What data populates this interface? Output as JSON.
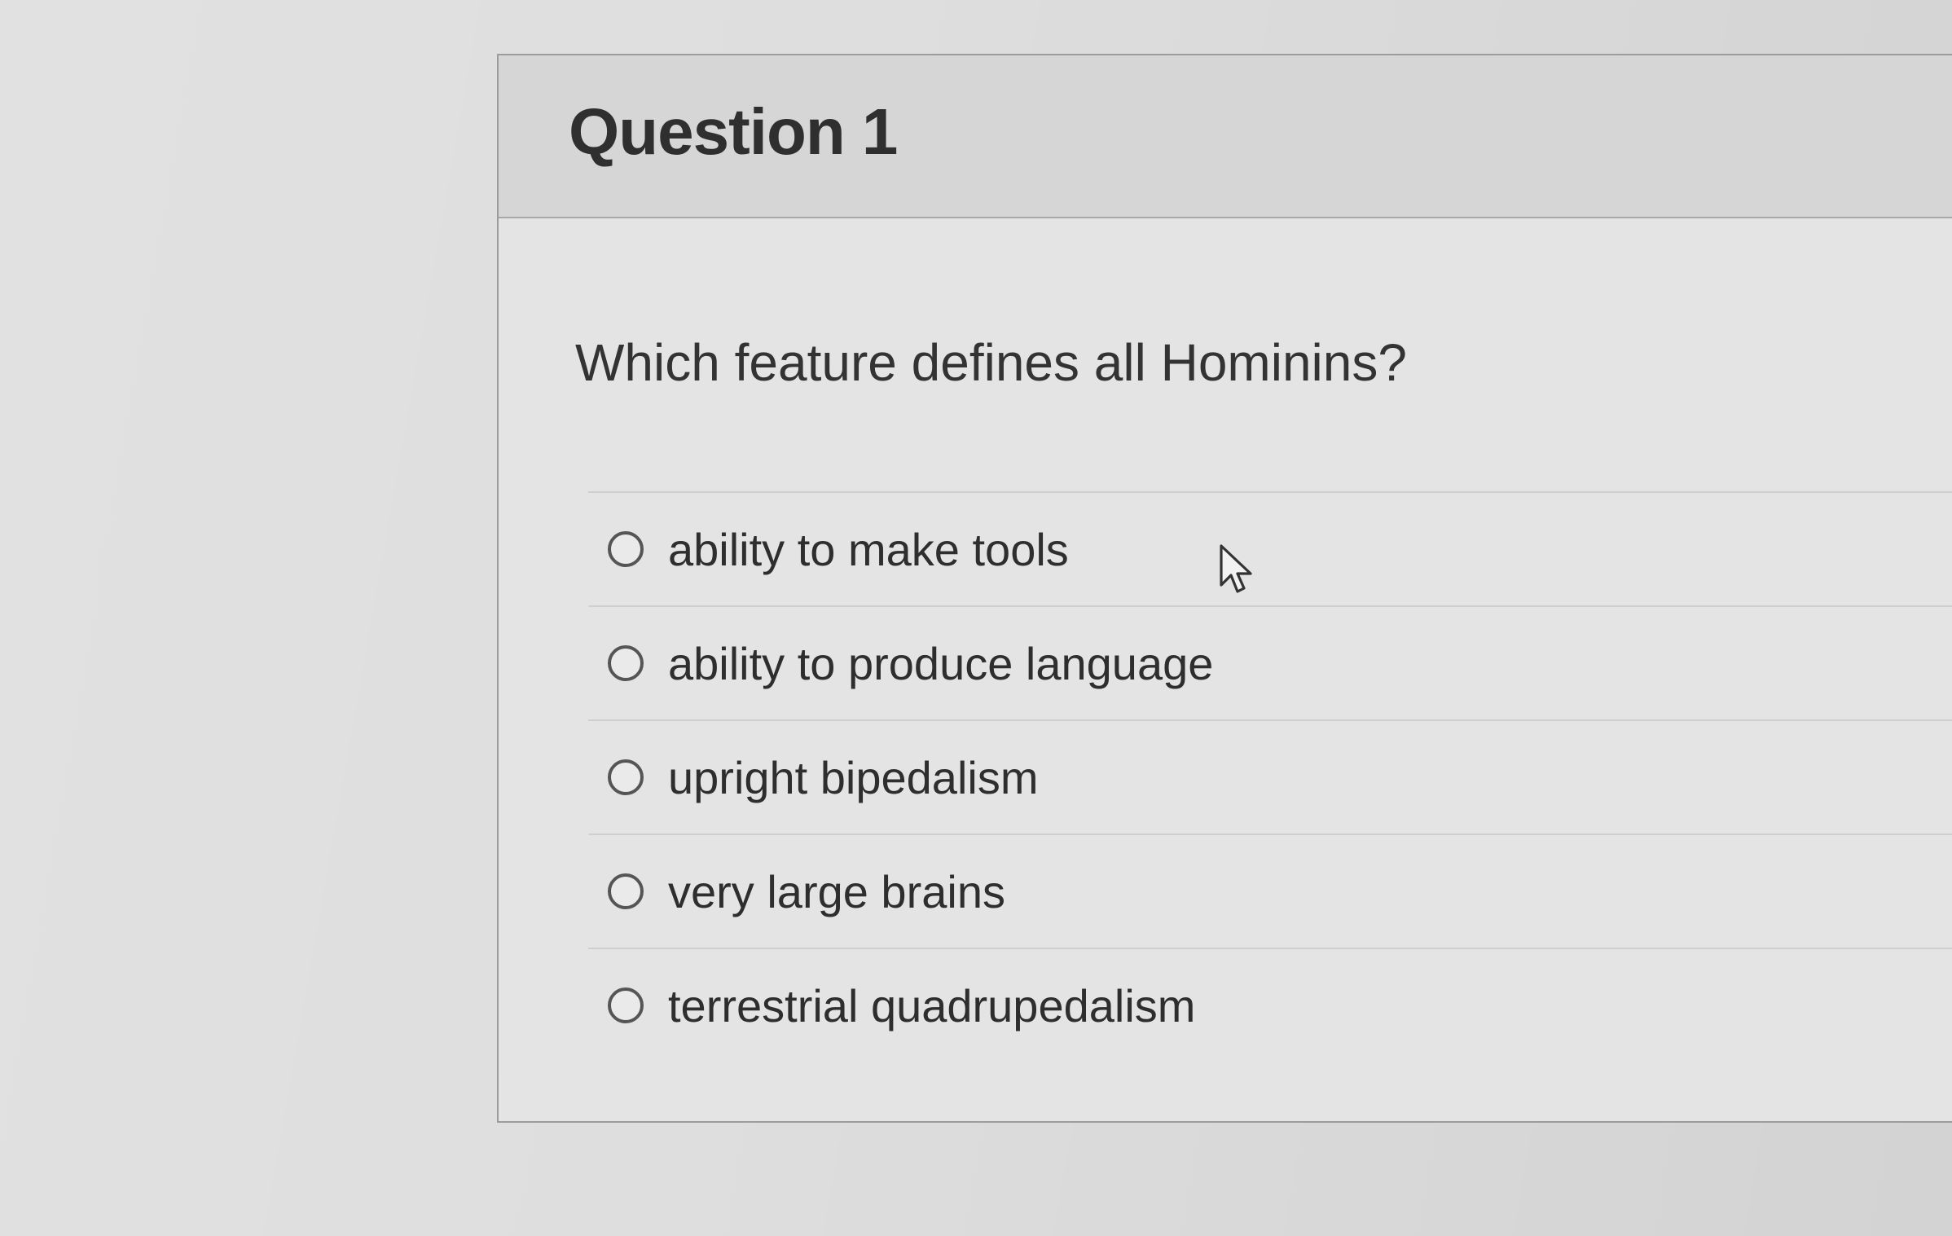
{
  "question": {
    "title": "Question 1",
    "prompt": "Which feature defines all Hominins?",
    "options": [
      {
        "label": "ability to make tools",
        "selected": false
      },
      {
        "label": "ability to produce language",
        "selected": false
      },
      {
        "label": "upright bipedalism",
        "selected": false
      },
      {
        "label": "very large brains",
        "selected": false
      },
      {
        "label": "terrestrial quadrupedalism",
        "selected": false
      }
    ]
  },
  "icons": {
    "option_control": "radio-button-icon",
    "pointer": "mouse-pointer-icon"
  },
  "colors": {
    "page_background": "#dedede",
    "header_background": "#d6d6d6",
    "card_background": "#e4e4e4",
    "text": "#2e2e2e"
  }
}
